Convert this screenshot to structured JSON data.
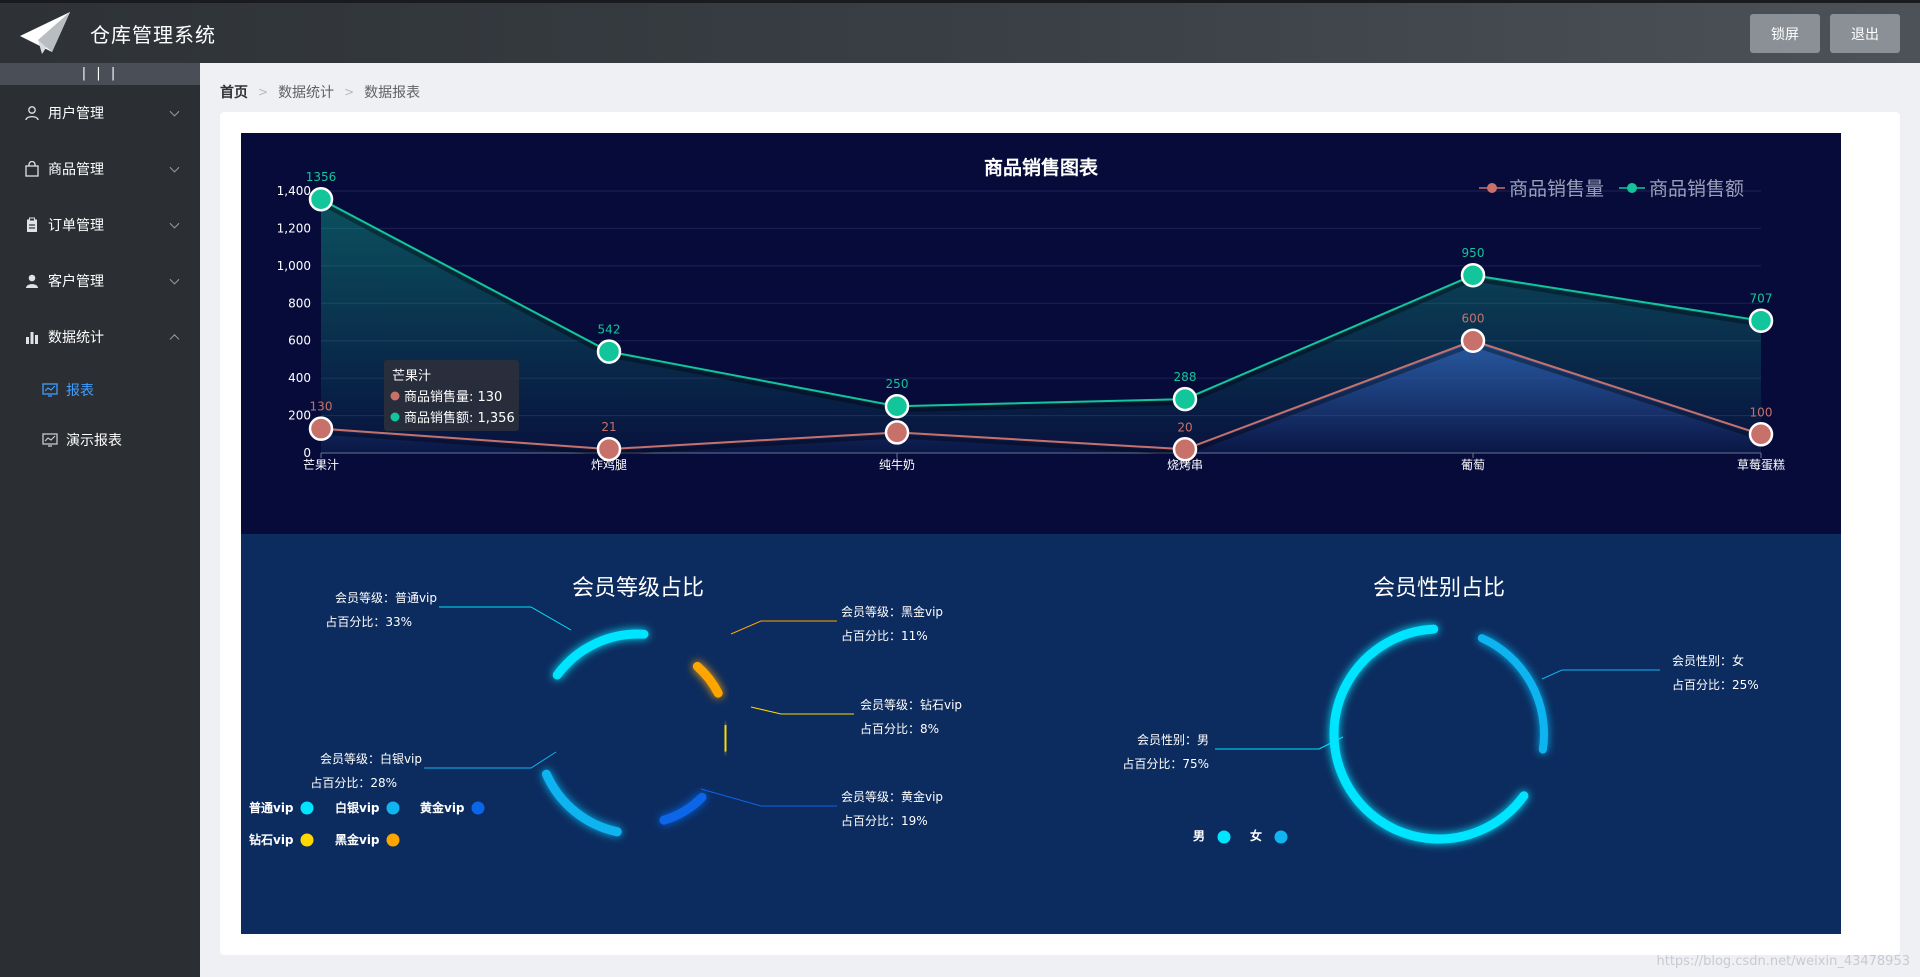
{
  "header": {
    "app_title": "仓库管理系统",
    "lock_label": "锁屏",
    "logout_label": "退出"
  },
  "sidebar": {
    "collapse_label": "| | |",
    "items": [
      {
        "label": "用户管理",
        "icon": "user-icon",
        "expanded": false
      },
      {
        "label": "商品管理",
        "icon": "bag-icon",
        "expanded": false
      },
      {
        "label": "订单管理",
        "icon": "clipboard-icon",
        "expanded": false
      },
      {
        "label": "客户管理",
        "icon": "customer-icon",
        "expanded": false
      },
      {
        "label": "数据统计",
        "icon": "bar-chart-icon",
        "expanded": true
      }
    ],
    "subitems": [
      {
        "label": "报表",
        "icon": "report-icon",
        "active": true
      },
      {
        "label": "演示报表",
        "icon": "report-icon",
        "active": false
      }
    ],
    "active_color": "#409eff"
  },
  "breadcrumb": [
    "首页",
    "数据统计",
    "数据报表"
  ],
  "watermark": "https://blog.csdn.net/weixin_43478953",
  "chart_data": [
    {
      "type": "line",
      "title": "商品销售图表",
      "categories": [
        "芒果汁",
        "炸鸡腿",
        "纯牛奶",
        "烧烤串",
        "葡萄",
        "草莓蛋糕"
      ],
      "series": [
        {
          "name": "商品销售量",
          "values": [
            130,
            21,
            110,
            20,
            600,
            100
          ],
          "color": "#c8716a",
          "labels": [
            "130",
            "21",
            "",
            "20",
            "600",
            "100"
          ]
        },
        {
          "name": "商品销售额",
          "values": [
            1356,
            542,
            250,
            288,
            950,
            707
          ],
          "color": "#13c59a",
          "labels": [
            "1356",
            "542",
            "250",
            "288",
            "950",
            "707"
          ]
        }
      ],
      "yticks": [
        "0",
        "200",
        "400",
        "600",
        "800",
        "1,000",
        "1,200",
        "1,400"
      ],
      "ylim": [
        0,
        1400
      ],
      "legend": "top-right",
      "tooltip": {
        "title": "芒果汁",
        "rows": [
          "商品销售量: 130",
          "商品销售额: 1,356"
        ]
      }
    },
    {
      "type": "pie",
      "title": "会员等级占比",
      "slices": [
        {
          "name": "普通vip",
          "value": 33,
          "color": "#00e5ff",
          "line1": "会员等级：普通vip",
          "line2": "占百分比：33%"
        },
        {
          "name": "白银vip",
          "value": 28,
          "color": "#10b4f0",
          "line1": "会员等级：白银vip",
          "line2": "占百分比：28%"
        },
        {
          "name": "黄金vip",
          "value": 19,
          "color": "#0a66e8",
          "line1": "会员等级：黄金vip",
          "line2": "占百分比：19%"
        },
        {
          "name": "钻石vip",
          "value": 8,
          "color": "#ffd800",
          "line1": "会员等级：钻石vip",
          "line2": "占百分比：8%"
        },
        {
          "name": "黑金vip",
          "value": 11,
          "color": "#ffa500",
          "line1": "会员等级：黑金vip",
          "line2": "占百分比：11%"
        }
      ],
      "legend": "bottom-left"
    },
    {
      "type": "pie",
      "title": "会员性别占比",
      "slices": [
        {
          "name": "男",
          "value": 75,
          "color": "#00e5ff",
          "line1": "会员性别：男",
          "line2": "占百分比：75%"
        },
        {
          "name": "女",
          "value": 25,
          "color": "#10b4f0",
          "line1": "会员性别：女",
          "line2": "占百分比：25%"
        }
      ],
      "legend": "bottom"
    }
  ]
}
